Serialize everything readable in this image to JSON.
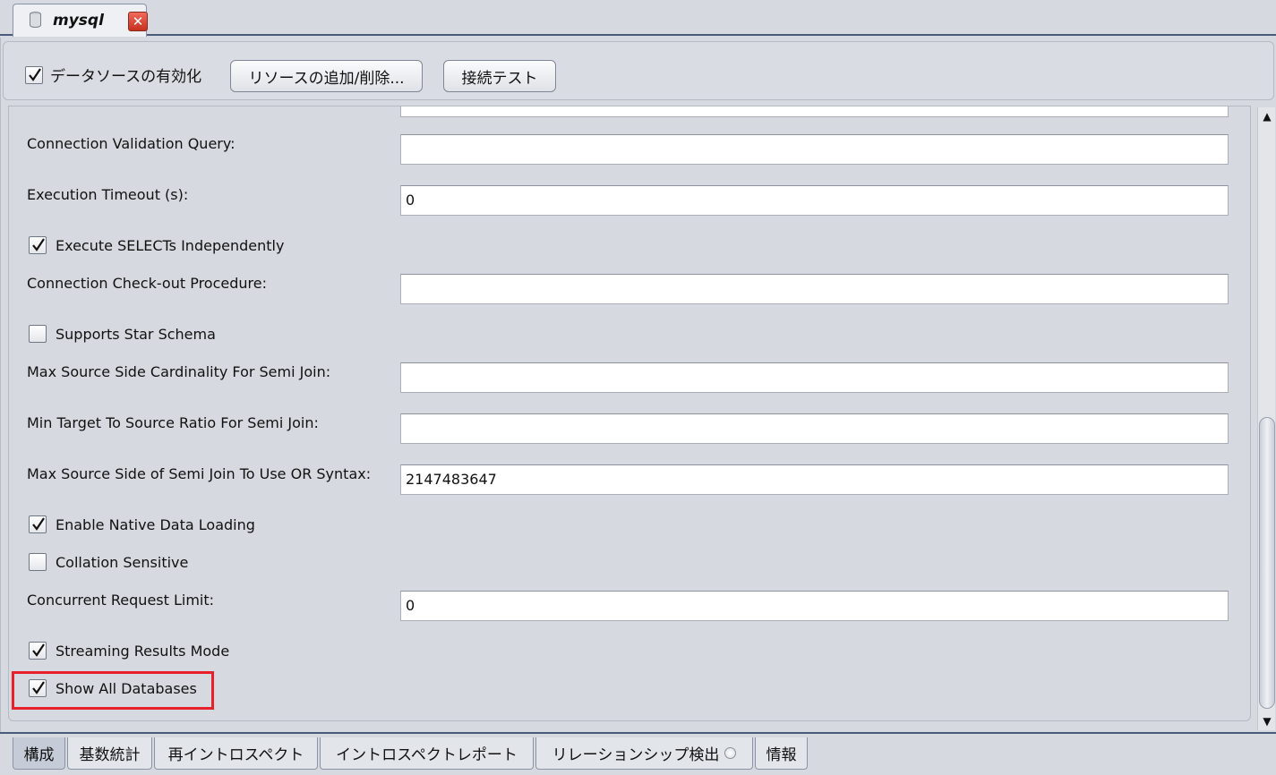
{
  "document_tab": {
    "title": "mysql",
    "icon": "database-icon",
    "close_icon": "close-icon"
  },
  "toolbar": {
    "enable_datasource": {
      "label": "データソースの有効化",
      "checked": true
    },
    "add_remove_resources_label": "リソースの追加/削除...",
    "connection_test_label": "接続テスト"
  },
  "form": {
    "connection_validation_query": {
      "label": "Connection Validation Query:",
      "value": ""
    },
    "execution_timeout": {
      "label": "Execution Timeout (s):",
      "value": "0"
    },
    "execute_selects_independently": {
      "label": "Execute SELECTs Independently",
      "checked": true
    },
    "connection_checkout_procedure": {
      "label": "Connection Check-out Procedure:",
      "value": ""
    },
    "supports_star_schema": {
      "label": "Supports Star Schema",
      "checked": false
    },
    "max_source_side_cardinality": {
      "label": "Max Source Side Cardinality For Semi Join:",
      "value": ""
    },
    "min_target_to_source_ratio": {
      "label": "Min Target To Source Ratio For Semi Join:",
      "value": ""
    },
    "max_source_side_or_syntax": {
      "label": "Max Source Side of Semi Join To Use OR Syntax:",
      "value": "2147483647"
    },
    "enable_native_data_loading": {
      "label": "Enable Native Data Loading",
      "checked": true
    },
    "collation_sensitive": {
      "label": "Collation Sensitive",
      "checked": false
    },
    "concurrent_request_limit": {
      "label": "Concurrent Request Limit:",
      "value": "0"
    },
    "streaming_results_mode": {
      "label": "Streaming Results Mode",
      "checked": true
    },
    "show_all_databases": {
      "label": "Show All Databases",
      "checked": true
    }
  },
  "bottom_tabs": [
    {
      "label": "構成",
      "active": true
    },
    {
      "label": "基数統計",
      "active": false
    },
    {
      "label": "再イントロスペクト",
      "active": false
    },
    {
      "label": "イントロスペクトレポート",
      "active": false
    },
    {
      "label": "リレーションシップ検出",
      "active": false
    },
    {
      "label": "情報",
      "active": false
    }
  ],
  "colors": {
    "highlight": "#e8202c",
    "tab_border": "#4a5a7a",
    "background": "#d6d9df"
  }
}
